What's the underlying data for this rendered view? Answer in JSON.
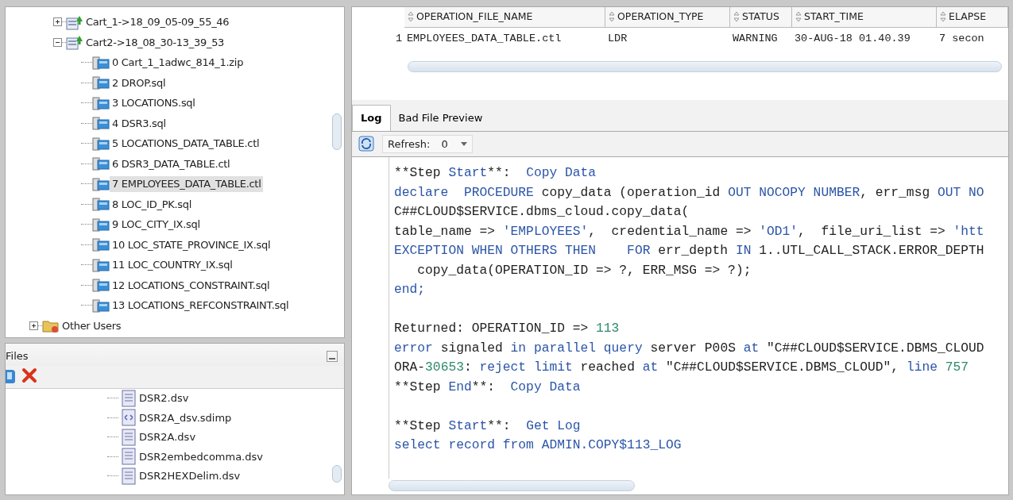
{
  "tree": [
    {
      "kind": "cart",
      "label": "Cart_1->18_09_05-09_55_46",
      "expanded": false
    },
    {
      "kind": "cart",
      "label": "Cart2->18_08_30-13_39_53",
      "expanded": true,
      "children": [
        {
          "label": "0 Cart_1_1adwc_814_1.zip",
          "selected": false
        },
        {
          "label": "2 DROP.sql",
          "selected": false
        },
        {
          "label": "3 LOCATIONS.sql",
          "selected": false
        },
        {
          "label": "4 DSR3.sql",
          "selected": false
        },
        {
          "label": "5 LOCATIONS_DATA_TABLE.ctl",
          "selected": false
        },
        {
          "label": "6 DSR3_DATA_TABLE.ctl",
          "selected": false
        },
        {
          "label": "7 EMPLOYEES_DATA_TABLE.ctl",
          "selected": true
        },
        {
          "label": "8 LOC_ID_PK.sql",
          "selected": false
        },
        {
          "label": "9 LOC_CITY_IX.sql",
          "selected": false
        },
        {
          "label": "10 LOC_STATE_PROVINCE_IX.sql",
          "selected": false
        },
        {
          "label": "11 LOC_COUNTRY_IX.sql",
          "selected": false
        },
        {
          "label": "12 LOCATIONS_CONSTRAINT.sql",
          "selected": false
        },
        {
          "label": "13 LOCATIONS_REFCONSTRAINT.sql",
          "selected": false
        }
      ]
    },
    {
      "kind": "folder",
      "label": "Other Users",
      "expanded": false
    }
  ],
  "files_panel": {
    "title": "Files",
    "items": [
      {
        "kind": "text",
        "label": "DSR2.dsv"
      },
      {
        "kind": "mapping",
        "label": "DSR2A_dsv.sdimp"
      },
      {
        "kind": "text",
        "label": "DSR2A.dsv"
      },
      {
        "kind": "text",
        "label": "DSR2embedcomma.dsv"
      },
      {
        "kind": "text",
        "label": "DSR2HEXDelim.dsv"
      }
    ]
  },
  "table": {
    "columns": [
      "OPERATION_FILE_NAME",
      "OPERATION_TYPE",
      "STATUS",
      "START_TIME",
      "ELAPSE"
    ],
    "rows": [
      {
        "number": "1",
        "cells": [
          "EMPLOYEES_DATA_TABLE.ctl",
          "LDR",
          "WARNING",
          "30-AUG-18 01.40.39",
          "7 secon"
        ]
      }
    ]
  },
  "tabs": [
    {
      "label": "Log",
      "selected": true
    },
    {
      "label": "Bad File Preview",
      "selected": false
    }
  ],
  "toolbar": {
    "refresh_label": "Refresh:",
    "refresh_value": "0"
  },
  "log": [
    {
      "kind": "code",
      "segments": [
        {
          "kind": "plain",
          "text": "**Step "
        },
        {
          "kind": "keyword",
          "text": "Start"
        },
        {
          "kind": "plain",
          "text": "**:  "
        },
        {
          "kind": "keyword",
          "text": "Copy Data"
        }
      ]
    },
    {
      "kind": "code",
      "segments": [
        {
          "kind": "keyword",
          "text": "declare  PROCEDURE"
        },
        {
          "kind": "plain",
          "text": " copy_data (operation_id "
        },
        {
          "kind": "keyword",
          "text": "OUT NOCOPY NUMBER"
        },
        {
          "kind": "plain",
          "text": ", err_msg "
        },
        {
          "kind": "keyword",
          "text": "OUT NO"
        }
      ]
    },
    {
      "kind": "code",
      "segments": [
        {
          "kind": "plain",
          "text": "C##CLOUD$SERVICE.dbms_cloud.copy_data("
        }
      ]
    },
    {
      "kind": "code",
      "segments": [
        {
          "kind": "plain",
          "text": "table_name => "
        },
        {
          "kind": "keyword",
          "text": "'EMPLOYEES'"
        },
        {
          "kind": "plain",
          "text": ",  credential_name => "
        },
        {
          "kind": "keyword",
          "text": "'OD1'"
        },
        {
          "kind": "plain",
          "text": ",  file_uri_list => "
        },
        {
          "kind": "keyword",
          "text": "'htt"
        }
      ]
    },
    {
      "kind": "code",
      "segments": [
        {
          "kind": "keyword",
          "text": "EXCEPTION WHEN OTHERS THEN    FOR"
        },
        {
          "kind": "plain",
          "text": " err_depth "
        },
        {
          "kind": "keyword",
          "text": "IN"
        },
        {
          "kind": "plain",
          "text": " 1..UTL_CALL_STACK.ERROR_DEPTH"
        }
      ]
    },
    {
      "kind": "code",
      "segments": [
        {
          "kind": "plain",
          "text": "   copy_data(OPERATION_ID => ?, ERR_MSG => ?);"
        }
      ]
    },
    {
      "kind": "code",
      "segments": [
        {
          "kind": "keyword",
          "text": "end;"
        }
      ]
    },
    {
      "kind": "blank"
    },
    {
      "kind": "code",
      "segments": [
        {
          "kind": "plain",
          "text": "Returned: OPERATION_ID => "
        },
        {
          "kind": "number",
          "text": "113"
        }
      ]
    },
    {
      "kind": "code",
      "segments": [
        {
          "kind": "keyword",
          "text": "error"
        },
        {
          "kind": "plain",
          "text": " signaled "
        },
        {
          "kind": "keyword",
          "text": "in parallel query"
        },
        {
          "kind": "plain",
          "text": " server P00S "
        },
        {
          "kind": "keyword",
          "text": "at"
        },
        {
          "kind": "plain",
          "text": " \"C##CLOUD$SERVICE.DBMS_CLOUD"
        }
      ]
    },
    {
      "kind": "code",
      "segments": [
        {
          "kind": "plain",
          "text": "ORA-"
        },
        {
          "kind": "number",
          "text": "30653"
        },
        {
          "kind": "plain",
          "text": ": "
        },
        {
          "kind": "keyword",
          "text": "reject limit"
        },
        {
          "kind": "plain",
          "text": " reached "
        },
        {
          "kind": "keyword",
          "text": "at"
        },
        {
          "kind": "plain",
          "text": " \"C##CLOUD$SERVICE.DBMS_CLOUD\", "
        },
        {
          "kind": "keyword",
          "text": "line"
        },
        {
          "kind": "number",
          "text": " 757"
        }
      ]
    },
    {
      "kind": "code",
      "segments": [
        {
          "kind": "plain",
          "text": "**Step "
        },
        {
          "kind": "keyword",
          "text": "End"
        },
        {
          "kind": "plain",
          "text": "**:  "
        },
        {
          "kind": "keyword",
          "text": "Copy Data"
        }
      ]
    },
    {
      "kind": "blank"
    },
    {
      "kind": "code",
      "segments": [
        {
          "kind": "plain",
          "text": "**Step "
        },
        {
          "kind": "keyword",
          "text": "Start"
        },
        {
          "kind": "plain",
          "text": "**:  "
        },
        {
          "kind": "keyword",
          "text": "Get Log"
        }
      ]
    },
    {
      "kind": "code",
      "segments": [
        {
          "kind": "keyword",
          "text": "select record from ADMIN.COPY$113_LOG"
        }
      ]
    }
  ]
}
